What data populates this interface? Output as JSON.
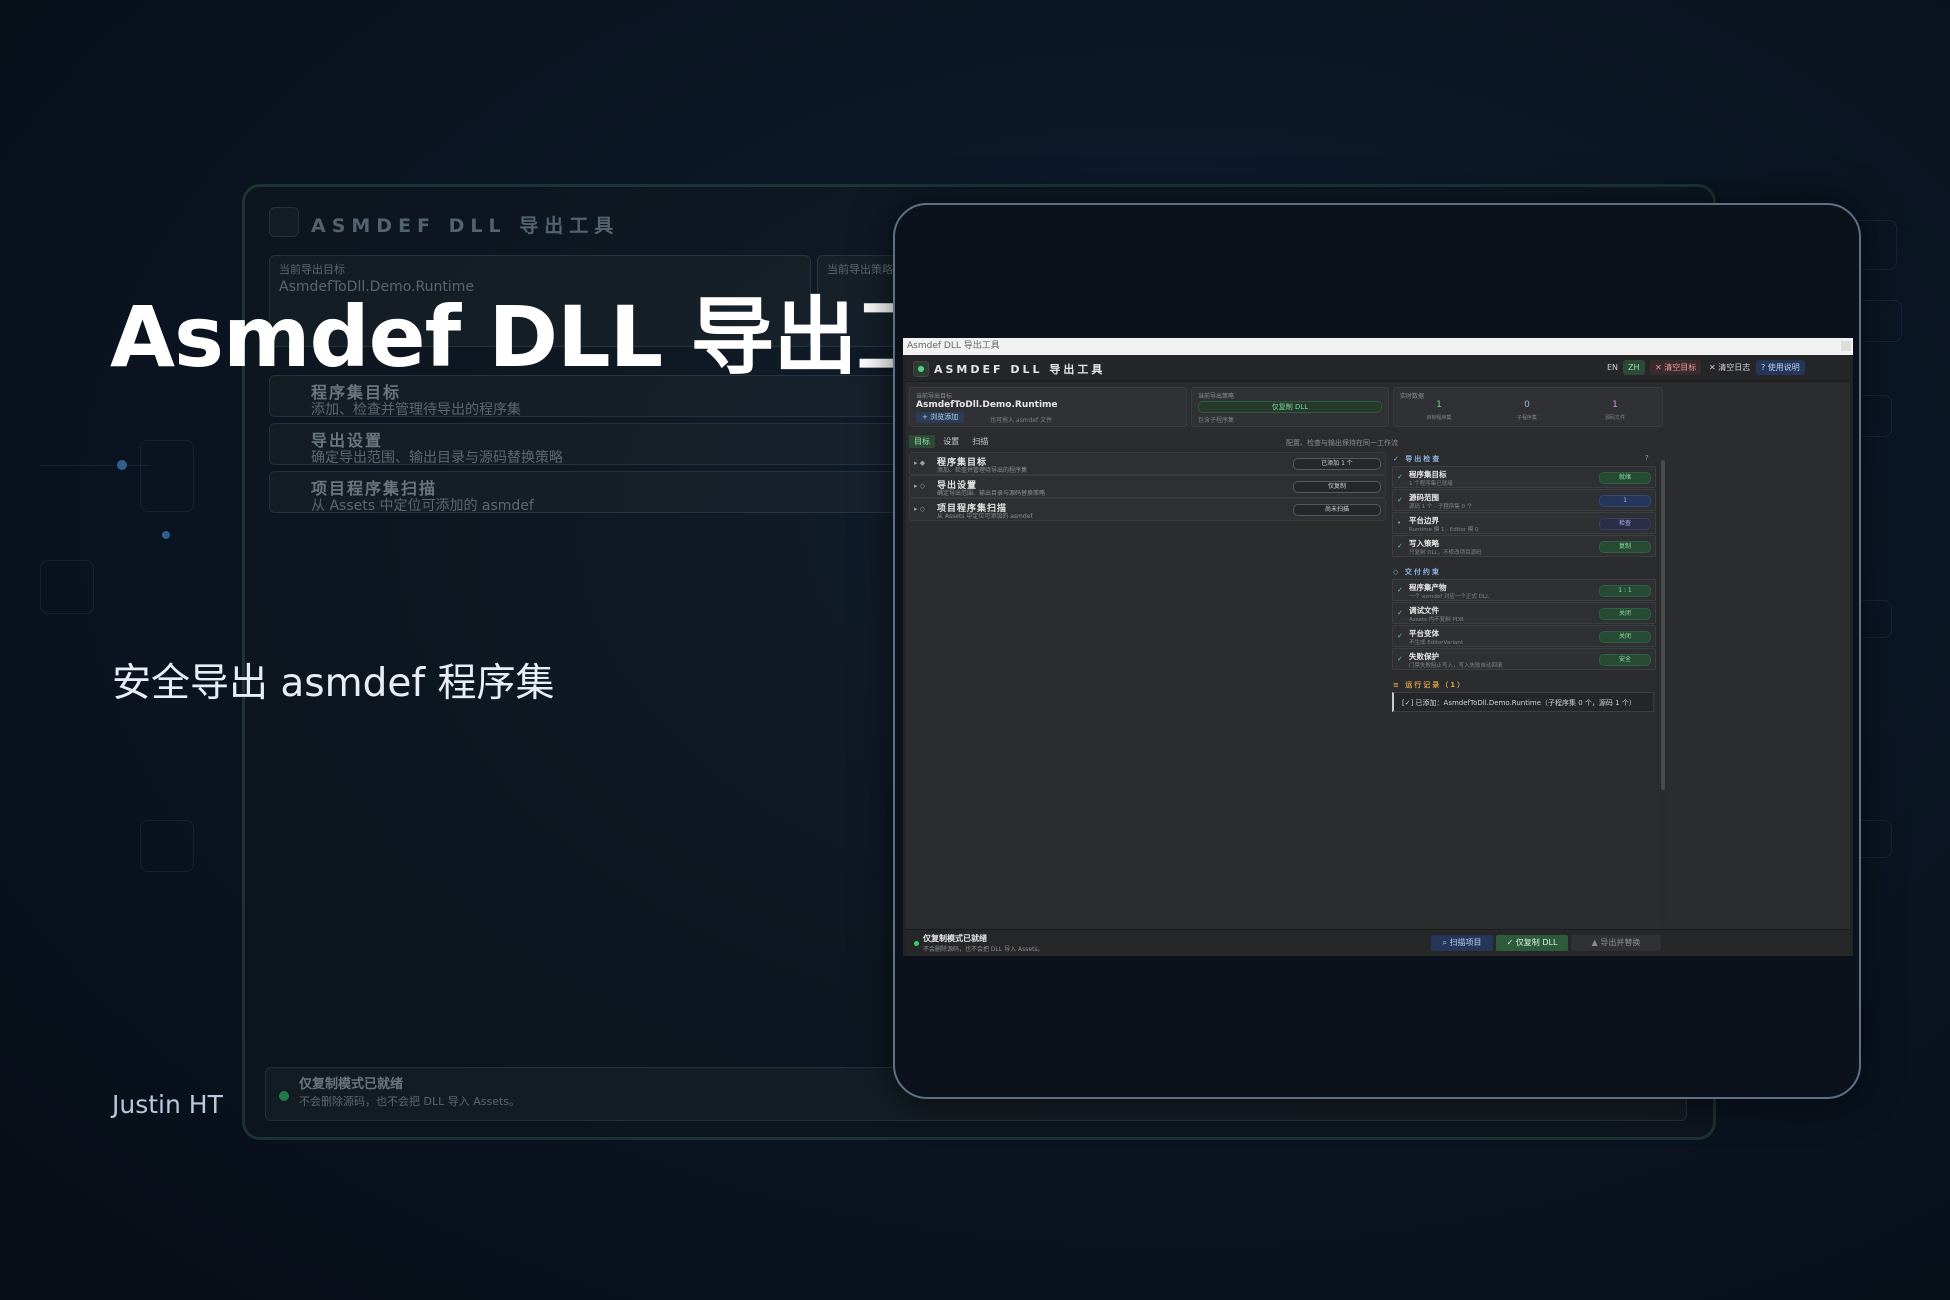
{
  "hero": {
    "title": "Asmdef DLL 导出工具",
    "subtitle": "安全导出 asmdef 程序集",
    "author": "Justin HT"
  },
  "ghost": {
    "title": "ASMDEF DLL 导出工具",
    "target_label": "当前导出目标",
    "target_value": "AsmdefToDll.Demo.Runtime",
    "strategy_label": "当前导出策略",
    "sections": [
      {
        "title": "程序集目标",
        "subtitle": "添加、检查并管理待导出的程序集"
      },
      {
        "title": "导出设置",
        "subtitle": "确定导出范围、输出目录与源码替换策略"
      },
      {
        "title": "项目程序集扫描",
        "subtitle": "从 Assets 中定位可添加的 asmdef"
      }
    ],
    "footer_title": "仅复制模式已就绪",
    "footer_sub": "不会删除源码，也不会把 DLL 导入 Assets。"
  },
  "window": {
    "titlebar": "Asmdef DLL 导出工具",
    "app_title": "ASMDEF DLL 导出工具",
    "buttons": {
      "en": "EN",
      "zh": "ZH",
      "clear_targets": "✕ 清空目标",
      "clear_log": "✕ 清空日志",
      "help": "? 使用说明"
    },
    "summary": {
      "target_label": "当前导出目标",
      "target_value": "AsmdefToDll.Demo.Runtime",
      "browse_button": "+ 浏览添加",
      "browse_hint": "也可拖入 asmdef 文件",
      "strategy_label": "当前导出策略",
      "strategy_value": "仅复制 DLL",
      "strategy_hint": "包含子程序集",
      "stats_label": "实时数据",
      "stats": [
        {
          "value": "1",
          "label": "目标程序集"
        },
        {
          "value": "0",
          "label": "子程序集"
        },
        {
          "value": "1",
          "label": "源码文件"
        }
      ]
    },
    "tabs": [
      "目标",
      "设置",
      "扫描"
    ],
    "tabs_hint": "配置、检查与输出保持在同一工作流",
    "sections": [
      {
        "title": "程序集目标",
        "subtitle": "添加、检查并管理待导出的程序集",
        "pill": "已添加 1 个"
      },
      {
        "title": "导出设置",
        "subtitle": "确定导出范围、输出目录与源码替换策略",
        "pill": "仅复制"
      },
      {
        "title": "项目程序集扫描",
        "subtitle": "从 Assets 中定位可添加的 asmdef",
        "pill": "尚未扫描"
      }
    ],
    "export_check": {
      "heading": "✓ 导出检查",
      "help": "?",
      "items": [
        {
          "title": "程序集目标",
          "subtitle": "1 个程序集已就绪",
          "pill": "就绪",
          "tone": "green"
        },
        {
          "title": "源码范围",
          "subtitle": "源码 1 个 · 子程序集 0 个",
          "pill": "1",
          "tone": "blue"
        },
        {
          "title": "平台边界",
          "subtitle": "Runtime 模 1 · Editor 模 0",
          "pill": "检查",
          "tone": "blue"
        },
        {
          "title": "写入策略",
          "subtitle": "只复制 DLL，不修改项目源码",
          "pill": "复制",
          "tone": "green"
        }
      ]
    },
    "delivery": {
      "heading": "◇ 交付约束",
      "items": [
        {
          "title": "程序集产物",
          "subtitle": "一个 asmdef 对应一个正式 DLL",
          "pill": "1 : 1",
          "tone": "green"
        },
        {
          "title": "调试文件",
          "subtitle": "Assets 内不复制 PDB",
          "pill": "关闭",
          "tone": "green"
        },
        {
          "title": "平台变体",
          "subtitle": "不生成 EditorVariant",
          "pill": "关闭",
          "tone": "green"
        },
        {
          "title": "失败保护",
          "subtitle": "门禁失败阻止写入，写入失败自动回滚",
          "pill": "安全",
          "tone": "green"
        }
      ]
    },
    "log": {
      "heading": "≡ 运行记录（1）",
      "entries": [
        "[✓] 已添加：AsmdefToDll.Demo.Runtime（子程序集 0 个，源码 1 个）"
      ]
    },
    "footer": {
      "title": "仅复制模式已就绪",
      "subtitle": "不会删除源码，也不会把 DLL 导入 Assets。",
      "scan_button": "⌕ 扫描项目",
      "copy_button": "✓ 仅复制 DLL",
      "replace_button": "▲ 导出并替换"
    }
  },
  "colors": {
    "accent_green": "#6fd18f",
    "accent_blue": "#9fbdf0",
    "warning_orange": "#d9a04a",
    "danger_red": "#e06060"
  }
}
